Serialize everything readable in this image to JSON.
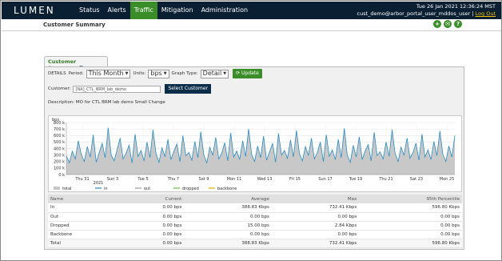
{
  "app": {
    "logo": "LUMEN",
    "nav": [
      {
        "label": "Status",
        "active": false
      },
      {
        "label": "Alerts",
        "active": false
      },
      {
        "label": "Traffic",
        "active": true
      },
      {
        "label": "Mitigation",
        "active": false
      },
      {
        "label": "Administration",
        "active": false
      }
    ],
    "datetime": "Tue 26 Jan 2021 12:36:24 MST",
    "user": "cust_demo@arbor_portal_user_mddos_user",
    "separator": "|",
    "logout": "Log Out",
    "accent_color": "#3a8d28",
    "nav_bg": "#0b1f33"
  },
  "subheader": {
    "title": "Customer Summary",
    "icons": [
      "add-icon",
      "mail-icon",
      "help-icon"
    ],
    "icon_glyphs": [
      "+",
      "✉",
      "?"
    ]
  },
  "panel": {
    "tab_label": "Customer Summary",
    "details_label": "DETAILS",
    "period_label": "Period:",
    "period_value": "This Month",
    "units_label": "Units:",
    "units_value": "bps",
    "graph_type_label": "Graph Type:",
    "graph_type_value": "Detail",
    "update_label": "Update",
    "customer_label": "Customer:",
    "customer_value": "[NA]_CTL_BRM_lab_demo",
    "select_customer_label": "Select Customer",
    "description": "Description: MO for CTL BRM lab demo Small Change"
  },
  "chart_data": {
    "type": "area",
    "ylabel": "bps",
    "y_ticks": [
      "0 k",
      "100 k",
      "200 k",
      "300 k",
      "400 k",
      "500 k",
      "600 k",
      "700 k",
      "800 k"
    ],
    "ylim": [
      0,
      800000
    ],
    "x_ticks": [
      "Thu 31",
      "Sun 3",
      "Tue 5",
      "Thu 7",
      "Sat 9",
      "Mon 11",
      "Wed 13",
      "Fri 15",
      "Sun 17",
      "Tue 19",
      "Thu 21",
      "Sat 23",
      "Mon 25"
    ],
    "x_sub_label": "2021",
    "grid": true,
    "legend": [
      "total",
      "in",
      "out",
      "dropped",
      "backbone"
    ],
    "legend_colors": [
      "#c8c8c8",
      "#2a8cc4",
      "#999999",
      "#6cbf3c",
      "#e0b000"
    ],
    "series": [
      {
        "name": "total",
        "values": [
          290,
          180,
          360,
          240,
          520,
          310,
          200,
          430,
          270,
          610,
          190,
          340,
          480,
          260,
          720,
          300,
          210,
          390,
          560,
          240,
          330,
          450,
          180,
          620,
          280,
          370,
          210,
          500,
          260,
          690,
          320,
          190,
          410,
          280,
          540,
          230,
          360,
          470,
          200,
          600,
          290,
          340,
          220,
          510,
          260,
          660,
          300,
          180,
          420,
          300,
          570,
          240,
          330,
          490,
          210,
          640,
          270,
          360,
          230,
          520,
          280,
          700,
          310,
          200,
          440,
          260,
          590,
          220,
          350,
          480,
          190,
          630,
          300,
          370,
          250,
          530,
          270,
          680,
          320,
          210,
          430,
          290,
          560,
          240,
          340,
          500,
          200,
          610,
          280,
          380,
          230,
          540,
          260,
          710,
          300,
          190,
          450,
          270,
          580,
          230,
          360,
          460,
          210,
          650,
          290,
          350,
          240,
          500,
          280,
          690,
          330,
          200,
          420,
          300,
          560,
          250,
          340,
          480,
          220,
          620,
          270,
          380,
          230,
          510,
          290,
          670,
          310,
          200,
          440,
          270,
          600
        ]
      },
      {
        "name": "in",
        "values": [
          290,
          180,
          360,
          240,
          520,
          310,
          200,
          430,
          270,
          610,
          190,
          340,
          480,
          260,
          720,
          300,
          210,
          390,
          560,
          240,
          330,
          450,
          180,
          620,
          280,
          370,
          210,
          500,
          260,
          690,
          320,
          190,
          410,
          280,
          540,
          230,
          360,
          470,
          200,
          600,
          290,
          340,
          220,
          510,
          260,
          660,
          300,
          180,
          420,
          300,
          570,
          240,
          330,
          490,
          210,
          640,
          270,
          360,
          230,
          520,
          280,
          700,
          310,
          200,
          440,
          260,
          590,
          220,
          350,
          480,
          190,
          630,
          300,
          370,
          250,
          530,
          270,
          680,
          320,
          210,
          430,
          290,
          560,
          240,
          340,
          500,
          200,
          610,
          280,
          380,
          230,
          540,
          260,
          710,
          300,
          190,
          450,
          270,
          580,
          230,
          360,
          460,
          210,
          650,
          290,
          350,
          240,
          500,
          280,
          690,
          330,
          200,
          420,
          300,
          560,
          250,
          340,
          480,
          220,
          620,
          270,
          380,
          230,
          510,
          290,
          670,
          310,
          200,
          440,
          270,
          600
        ]
      }
    ]
  },
  "table": {
    "headers": [
      "Name",
      "Current",
      "Average",
      "Max",
      "95th Percentile"
    ],
    "rows": [
      [
        "In",
        "0.00 bps",
        "388.83 Kbps",
        "732.41 Kbps",
        "596.80 Kbps"
      ],
      [
        "Out",
        "0.00 bps",
        "0.00 bps",
        "0.00 bps",
        "0.00 bps"
      ],
      [
        "Dropped",
        "0.00 bps",
        "15.00 bps",
        "2.84 Kbps",
        "0.00 bps"
      ],
      [
        "Backbone",
        "0.00 bps",
        "0.00 bps",
        "0.00 bps",
        "0.00 bps"
      ],
      [
        "Total",
        "0.00 bps",
        "388.83 Kbps",
        "732.41 Kbps",
        "596.80 Kbps"
      ]
    ]
  }
}
